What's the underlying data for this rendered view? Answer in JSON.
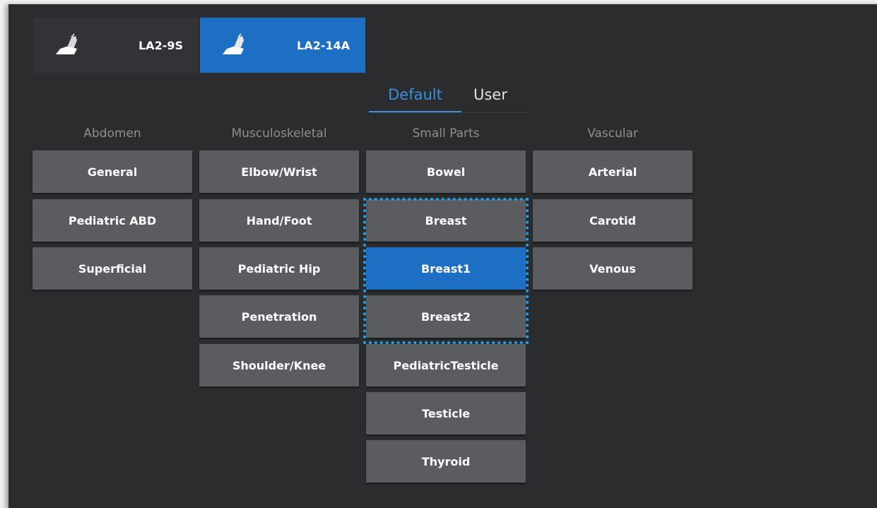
{
  "probes": [
    {
      "label": "LA2-9S",
      "icon": "linear-probe-icon",
      "selected": false
    },
    {
      "label": "LA2-14A",
      "icon": "linear-probe-icon",
      "selected": true
    }
  ],
  "tabs": {
    "default_label": "Default",
    "user_label": "User",
    "active": "Default"
  },
  "columns": {
    "abdomen": {
      "header": "Abdomen",
      "presets": [
        "General",
        "Pediatric ABD",
        "Superficial"
      ]
    },
    "musculoskeletal": {
      "header": "Musculoskeletal",
      "presets": [
        "Elbow/Wrist",
        "Hand/Foot",
        "Pediatric Hip",
        "Penetration",
        "Shoulder/Knee"
      ]
    },
    "small_parts": {
      "header": "Small Parts",
      "presets": [
        "Bowel",
        "Breast",
        "Breast1",
        "Breast2",
        "PediatricTesticle",
        "Testicle",
        "Thyroid"
      ],
      "selected": "Breast1",
      "focused_group": [
        "Breast",
        "Breast1",
        "Breast2"
      ]
    },
    "vascular": {
      "header": "Vascular",
      "presets": [
        "Arterial",
        "Carotid",
        "Venous"
      ]
    }
  },
  "colors": {
    "background": "#2b2c2e",
    "button": "#5a5c60",
    "accent": "#1d6fc4",
    "tab_active": "#3a8fe0",
    "focus_ring": "#1aa3f0"
  }
}
